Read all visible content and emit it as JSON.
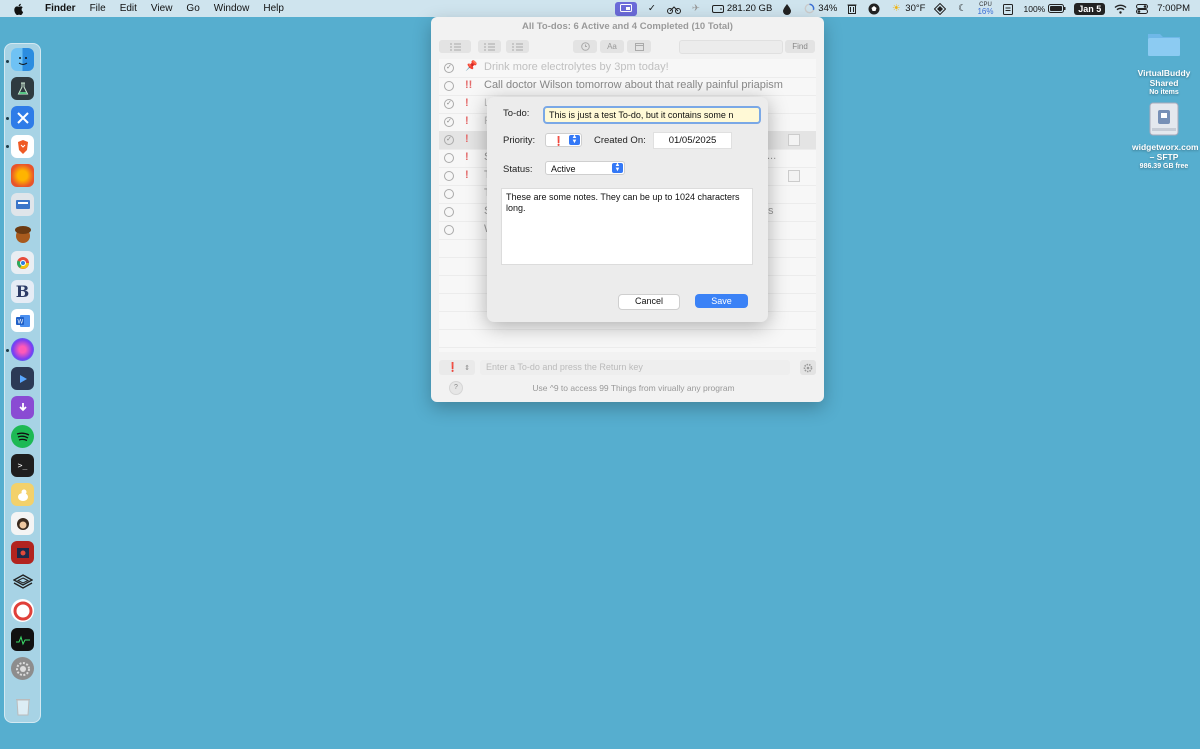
{
  "menubar": {
    "app_name": "Finder",
    "items": [
      "File",
      "Edit",
      "View",
      "Go",
      "Window",
      "Help"
    ],
    "status": {
      "disk": "281.20 GB",
      "battery_ring": "34%",
      "weather": "30°F",
      "cpu_label": "CPU",
      "cpu_value": "16%",
      "battery": "100%",
      "date": "Jan 5",
      "time": "7:00PM"
    }
  },
  "desktop": {
    "icons": [
      {
        "name": "VirtualBuddy Shared",
        "sub": "No items"
      },
      {
        "name": "widgetworx.com – SFTP",
        "sub": "986.39 GB free"
      }
    ]
  },
  "window": {
    "title": "All To-dos: 6 Active and 4 Completed (10 Total)",
    "toolbar": {
      "find_label": "Find",
      "font_label": "Aa"
    },
    "rows": [
      {
        "text": "Drink more electrolytes by 3pm today!",
        "prio": "📌",
        "done": true
      },
      {
        "text": "Call doctor Wilson tomorrow about that really painful priapism",
        "prio": "!!",
        "done": false
      },
      {
        "text": "L",
        "prio": "!",
        "done": true
      },
      {
        "text": "F",
        "prio": "!",
        "done": true
      },
      {
        "text": "",
        "prio": "!",
        "done": true
      },
      {
        "text": "S",
        "prio": "!",
        "done": false
      },
      {
        "text": "T",
        "prio": "!",
        "done": false
      },
      {
        "text": "T",
        "prio": "",
        "done": false
      },
      {
        "text": "S",
        "prio": "",
        "done": false
      },
      {
        "text": "W",
        "prio": "",
        "done": false
      }
    ],
    "row5_suffix": "...",
    "row9_suffix": "s",
    "input_placeholder": "Enter a To-do and press the Return key",
    "footer_hint": "Use ^9 to access 99 Things from virually any program",
    "help_label": "?"
  },
  "dialog": {
    "todo_label": "To-do:",
    "todo_value": "This is just a test To-do, but it contains some n",
    "priority_label": "Priority:",
    "priority_value": "❗",
    "created_label": "Created On:",
    "created_value": "01/05/2025",
    "status_label": "Status:",
    "status_value": "Active",
    "notes": "These are some notes. They can be up to 1024 characters long.",
    "cancel_label": "Cancel",
    "save_label": "Save"
  }
}
